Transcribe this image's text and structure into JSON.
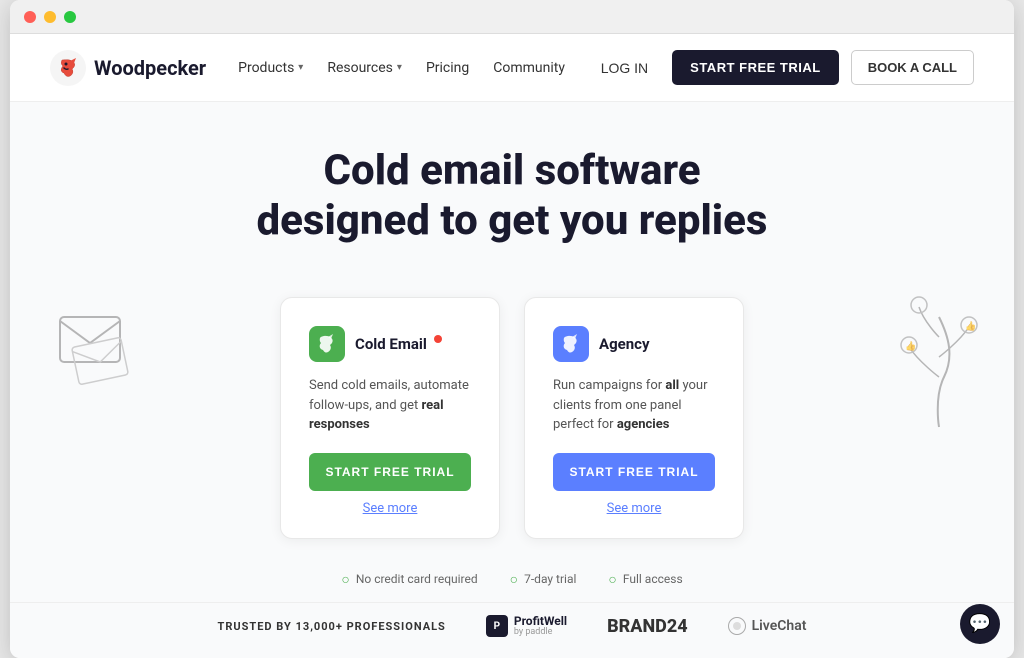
{
  "browser": {
    "traffic_lights": [
      "red",
      "yellow",
      "green"
    ]
  },
  "navbar": {
    "logo_text": "Woodpecker",
    "nav_items": [
      {
        "label": "Products",
        "has_dropdown": true
      },
      {
        "label": "Resources",
        "has_dropdown": true
      },
      {
        "label": "Pricing",
        "has_dropdown": false
      },
      {
        "label": "Community",
        "has_dropdown": false
      }
    ],
    "login_label": "LOG IN",
    "start_trial_label": "START FREE TRIAL",
    "book_call_label": "BOOK A CALL"
  },
  "hero": {
    "title_line1": "Cold email software",
    "title_line2": "designed to get you replies"
  },
  "cards": [
    {
      "id": "cold-email",
      "icon_color": "green",
      "title": "Cold Email",
      "has_badge": true,
      "description": "Send cold emails, automate follow-ups, and get real responses",
      "cta_label": "START FREE TRIAL",
      "see_more_label": "See more"
    },
    {
      "id": "agency",
      "icon_color": "blue",
      "title": "Agency",
      "has_badge": false,
      "description": "Run campaigns for all your clients from one panel perfect for agencies",
      "cta_label": "START FREE TRIAL",
      "see_more_label": "See more"
    }
  ],
  "trust_badges": [
    {
      "label": "No credit card required"
    },
    {
      "label": "7-day trial"
    },
    {
      "label": "Full access"
    }
  ],
  "bottom_bar": {
    "trusted_label": "TRUSTED BY 13,000+ PROFESSIONALS",
    "brands": [
      {
        "name": "ProfitWell",
        "type": "logo"
      },
      {
        "name": "BRAND24",
        "type": "text"
      },
      {
        "name": "LiveChat",
        "type": "text"
      }
    ]
  },
  "chat": {
    "icon": "💬"
  }
}
